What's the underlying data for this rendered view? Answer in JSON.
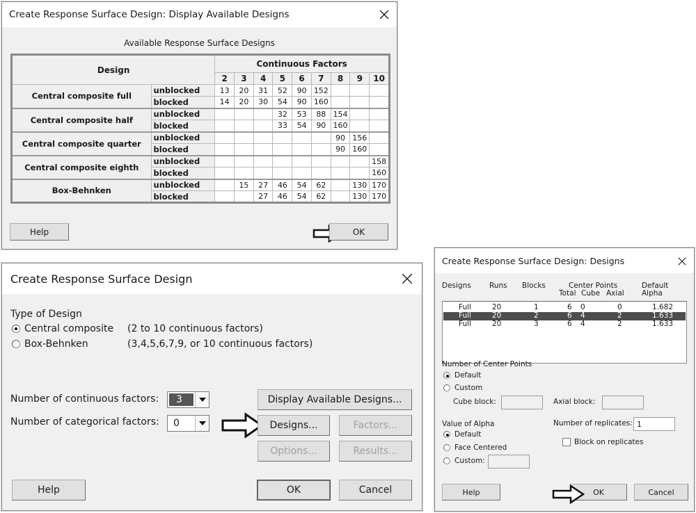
{
  "available_dialog": {
    "title": "Create Response Surface Design: Display Available Designs",
    "caption": "Available Response Surface Designs",
    "table": {
      "design_header": "Design",
      "factors_header": "Continuous Factors",
      "factor_columns": [
        "2",
        "3",
        "4",
        "5",
        "6",
        "7",
        "8",
        "9",
        "10"
      ],
      "groups": [
        {
          "name": "Central composite full",
          "rows": [
            {
              "label": "unblocked",
              "values": [
                "13",
                "20",
                "31",
                "52",
                "90",
                "152",
                "",
                "",
                ""
              ]
            },
            {
              "label": "blocked",
              "values": [
                "14",
                "20",
                "30",
                "54",
                "90",
                "160",
                "",
                "",
                ""
              ]
            }
          ]
        },
        {
          "name": "Central composite half",
          "rows": [
            {
              "label": "unblocked",
              "values": [
                "",
                "",
                "",
                "32",
                "53",
                "88",
                "154",
                "",
                ""
              ]
            },
            {
              "label": "blocked",
              "values": [
                "",
                "",
                "",
                "33",
                "54",
                "90",
                "160",
                "",
                ""
              ]
            }
          ]
        },
        {
          "name": "Central composite quarter",
          "rows": [
            {
              "label": "unblocked",
              "values": [
                "",
                "",
                "",
                "",
                "",
                "",
                "90",
                "156",
                ""
              ]
            },
            {
              "label": "blocked",
              "values": [
                "",
                "",
                "",
                "",
                "",
                "",
                "90",
                "160",
                ""
              ]
            }
          ]
        },
        {
          "name": "Central composite eighth",
          "rows": [
            {
              "label": "unblocked",
              "values": [
                "",
                "",
                "",
                "",
                "",
                "",
                "",
                "",
                "158"
              ]
            },
            {
              "label": "blocked",
              "values": [
                "",
                "",
                "",
                "",
                "",
                "",
                "",
                "",
                "160"
              ]
            }
          ]
        },
        {
          "name": "Box-Behnken",
          "rows": [
            {
              "label": "unblocked",
              "values": [
                "",
                "15",
                "27",
                "46",
                "54",
                "62",
                "",
                "130",
                "170"
              ]
            },
            {
              "label": "blocked",
              "values": [
                "",
                "",
                "27",
                "46",
                "54",
                "62",
                "",
                "130",
                "170"
              ]
            }
          ]
        }
      ]
    },
    "help_label": "Help",
    "ok_label": "OK"
  },
  "main_dialog": {
    "title": "Create Response Surface Design",
    "type_of_design_label": "Type of Design",
    "options": [
      {
        "label": "Central composite",
        "note": "(2 to 10 continuous factors)",
        "selected": true
      },
      {
        "label": "Box-Behnken",
        "note": "(3,4,5,6,7,9, or 10 continuous factors)",
        "selected": false
      }
    ],
    "continuous_label": "Number of continuous factors:",
    "continuous_value": "3",
    "categorical_label": "Number of categorical factors:",
    "categorical_value": "0",
    "display_designs_label": "Display Available Designs...",
    "designs_label": "Designs...",
    "factors_label": "Factors...",
    "options_label": "Options...",
    "results_label": "Results...",
    "help_label": "Help",
    "ok_label": "OK",
    "cancel_label": "Cancel"
  },
  "designs_dialog": {
    "title": "Create Response Surface Design: Designs",
    "headers": {
      "designs": "Designs",
      "runs": "Runs",
      "blocks": "Blocks",
      "center_points": "Center Points",
      "total": "Total",
      "cube": "Cube",
      "axial": "Axial",
      "default": "Default",
      "alpha": "Alpha"
    },
    "rows": [
      {
        "design": "Full",
        "runs": "20",
        "blocks": "1",
        "total": "6",
        "cube": "0",
        "axial": "0",
        "alpha": "1.682",
        "selected": false
      },
      {
        "design": "Full",
        "runs": "20",
        "blocks": "2",
        "total": "6",
        "cube": "4",
        "axial": "2",
        "alpha": "1.633",
        "selected": true
      },
      {
        "design": "Full",
        "runs": "20",
        "blocks": "3",
        "total": "6",
        "cube": "4",
        "axial": "2",
        "alpha": "1.633",
        "selected": false
      }
    ],
    "center_points_label": "Number of Center Points",
    "cp_default": "Default",
    "cp_custom": "Custom",
    "cube_block_label": "Cube block:",
    "axial_block_label": "Axial block:",
    "alpha_label": "Value of Alpha",
    "alpha_default": "Default",
    "alpha_face": "Face Centered",
    "alpha_custom": "Custom:",
    "replicates_label": "Number of replicates:",
    "replicates_value": "1",
    "block_on_replicates": "Block on replicates",
    "help_label": "Help",
    "ok_label": "OK",
    "cancel_label": "Cancel"
  }
}
